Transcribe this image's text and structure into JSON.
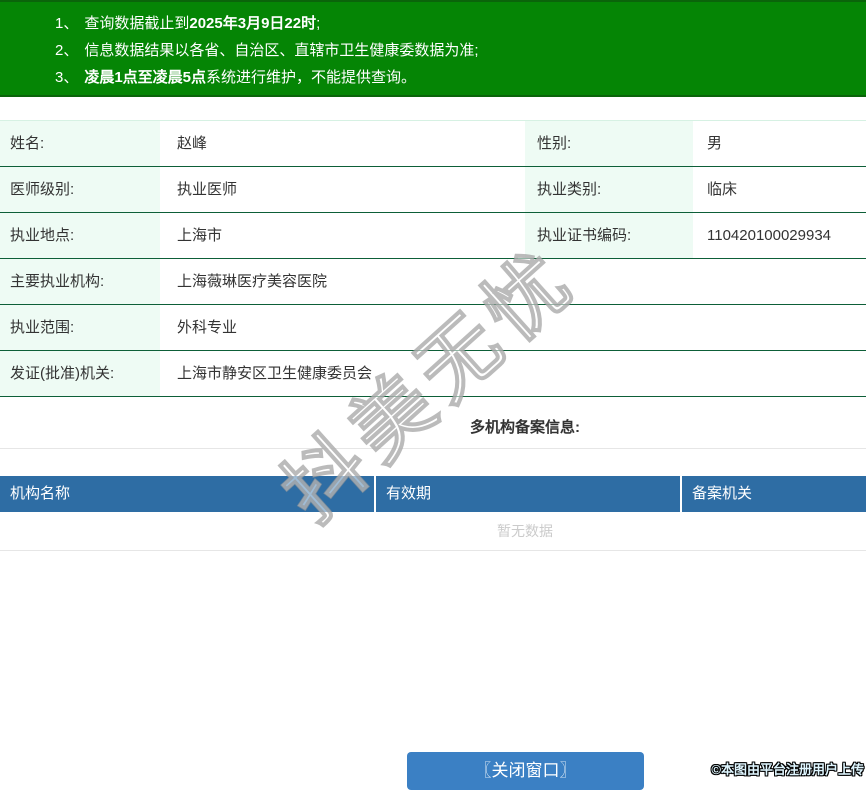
{
  "colors": {
    "banner-green": "#058505",
    "banner-green-dark": "#0a640a",
    "row-border-green": "#0d5f38",
    "label-mint": "#eefbf4",
    "table-top-green": "#d6f1e3",
    "filing-header-blue": "#2e6da4",
    "button-blue": "#3b80c4",
    "empty-gray": "#cbcbcb",
    "divider-gray": "#e6e6e6",
    "text-dark": "#333333"
  },
  "notices": [
    {
      "num": "1、",
      "pre": "查询数据截止到",
      "bold": "2025年3月9日22时",
      "post": ";"
    },
    {
      "num": "2、",
      "pre": "信息数据结果以各省、自治区、直辖市卫生健康委数据为准;",
      "bold": "",
      "post": ""
    },
    {
      "num": "3、",
      "pre": "",
      "bold": "凌晨1点至凌晨5点",
      "post": "系统进行维护，不能提供查询。"
    }
  ],
  "info": {
    "rows": [
      {
        "label": "姓名:",
        "value": "赵峰",
        "label2": "性别:",
        "value2": "男"
      },
      {
        "label": "医师级别:",
        "value": "执业医师",
        "label2": "执业类别:",
        "value2": "临床"
      },
      {
        "label": "执业地点:",
        "value": "上海市",
        "label2": "执业证书编码:",
        "value2": "110420100029934"
      },
      {
        "label": "主要执业机构:",
        "value": "上海薇琳医疗美容医院"
      },
      {
        "label": "执业范围:",
        "value": "外科专业"
      },
      {
        "label": "发证(批准)机关:",
        "value": "上海市静安区卫生健康委员会"
      }
    ]
  },
  "filing": {
    "title": "多机构备案信息:",
    "columns": [
      "机构名称",
      "有效期",
      "备案机关"
    ],
    "empty_text": "暂无数据"
  },
  "close_button": {
    "label": "〖关闭窗口〗"
  },
  "watermark": {
    "text": "抖美无忧"
  },
  "image_credit": "©本图由平台注册用户上传"
}
